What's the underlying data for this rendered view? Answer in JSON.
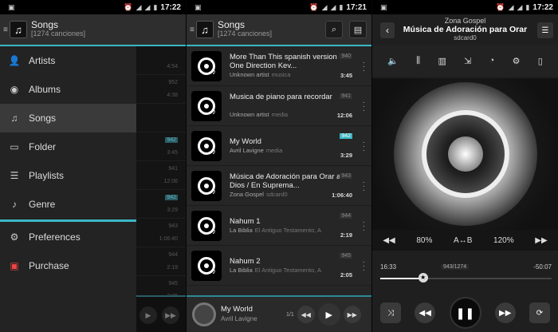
{
  "status": {
    "time1": "17:22",
    "time2": "17:21",
    "time3": "17:22"
  },
  "header": {
    "title": "Songs",
    "subtitle": "[1274 canciones]"
  },
  "drawer": {
    "items": [
      {
        "label": "Artists",
        "icon": "person-icon"
      },
      {
        "label": "Albums",
        "icon": "disc-icon"
      },
      {
        "label": "Songs",
        "icon": "note-icon"
      },
      {
        "label": "Folder",
        "icon": "folder-icon"
      },
      {
        "label": "Playlists",
        "icon": "playlist-icon"
      },
      {
        "label": "Genre",
        "icon": "guitar-icon"
      },
      {
        "label": "Preferences",
        "icon": "gear-icon"
      },
      {
        "label": "Purchase",
        "icon": "gift-icon"
      }
    ]
  },
  "underlist": [
    {
      "num": "",
      "dur": "4:54"
    },
    {
      "num": "952",
      "dur": "4:38"
    },
    {
      "num": "",
      "dur": ""
    },
    {
      "num": "942",
      "dur": "3:45"
    },
    {
      "num": "941",
      "dur": "12:06"
    },
    {
      "num": "942",
      "dur": "3:29"
    },
    {
      "num": "943",
      "dur": "1:06:40"
    },
    {
      "num": "944",
      "dur": "2:19"
    },
    {
      "num": "945",
      "dur": "2:05"
    }
  ],
  "songs": [
    {
      "title": "More Than This spanish version - One Direction Kev...",
      "artist": "Unknown artist",
      "album": "musica",
      "num": "940",
      "dur": "3:45",
      "hl": false
    },
    {
      "title": "Musica de piano para recordar",
      "artist": "Unknown artist",
      "album": "media",
      "num": "941",
      "dur": "12:06",
      "hl": false
    },
    {
      "title": "My World",
      "artist": "Avril Lavigne",
      "album": "media",
      "num": "942",
      "dur": "3:29",
      "hl": true
    },
    {
      "title": "Música de Adoración para Orar a Dios / En Suprema...",
      "artist": "Zona Gospel",
      "album": "sdcard0",
      "num": "943",
      "dur": "1:06:40",
      "hl": false
    },
    {
      "title": "Nahum 1",
      "artist": "La Biblia",
      "album": "El Antiguo Testamento, A",
      "num": "944",
      "dur": "2:19",
      "hl": false
    },
    {
      "title": "Nahum 2",
      "artist": "La Biblia",
      "album": "El Antiguo Testamento, A",
      "num": "945",
      "dur": "2:05",
      "hl": false
    }
  ],
  "mini": {
    "title": "My World",
    "artist": "Avril Lavigne",
    "count": "1/1"
  },
  "player": {
    "artist": "Zona Gospel",
    "title": "Música de Adoración para Orar",
    "source": "sdcard0",
    "speed": "80%",
    "ab": "A↔B",
    "pitch": "120%",
    "elapsed": "16:33",
    "position": "943/1274",
    "remaining": "-50:07",
    "progress": 0.25
  },
  "colors": {
    "accent": "#3cb7c4"
  }
}
